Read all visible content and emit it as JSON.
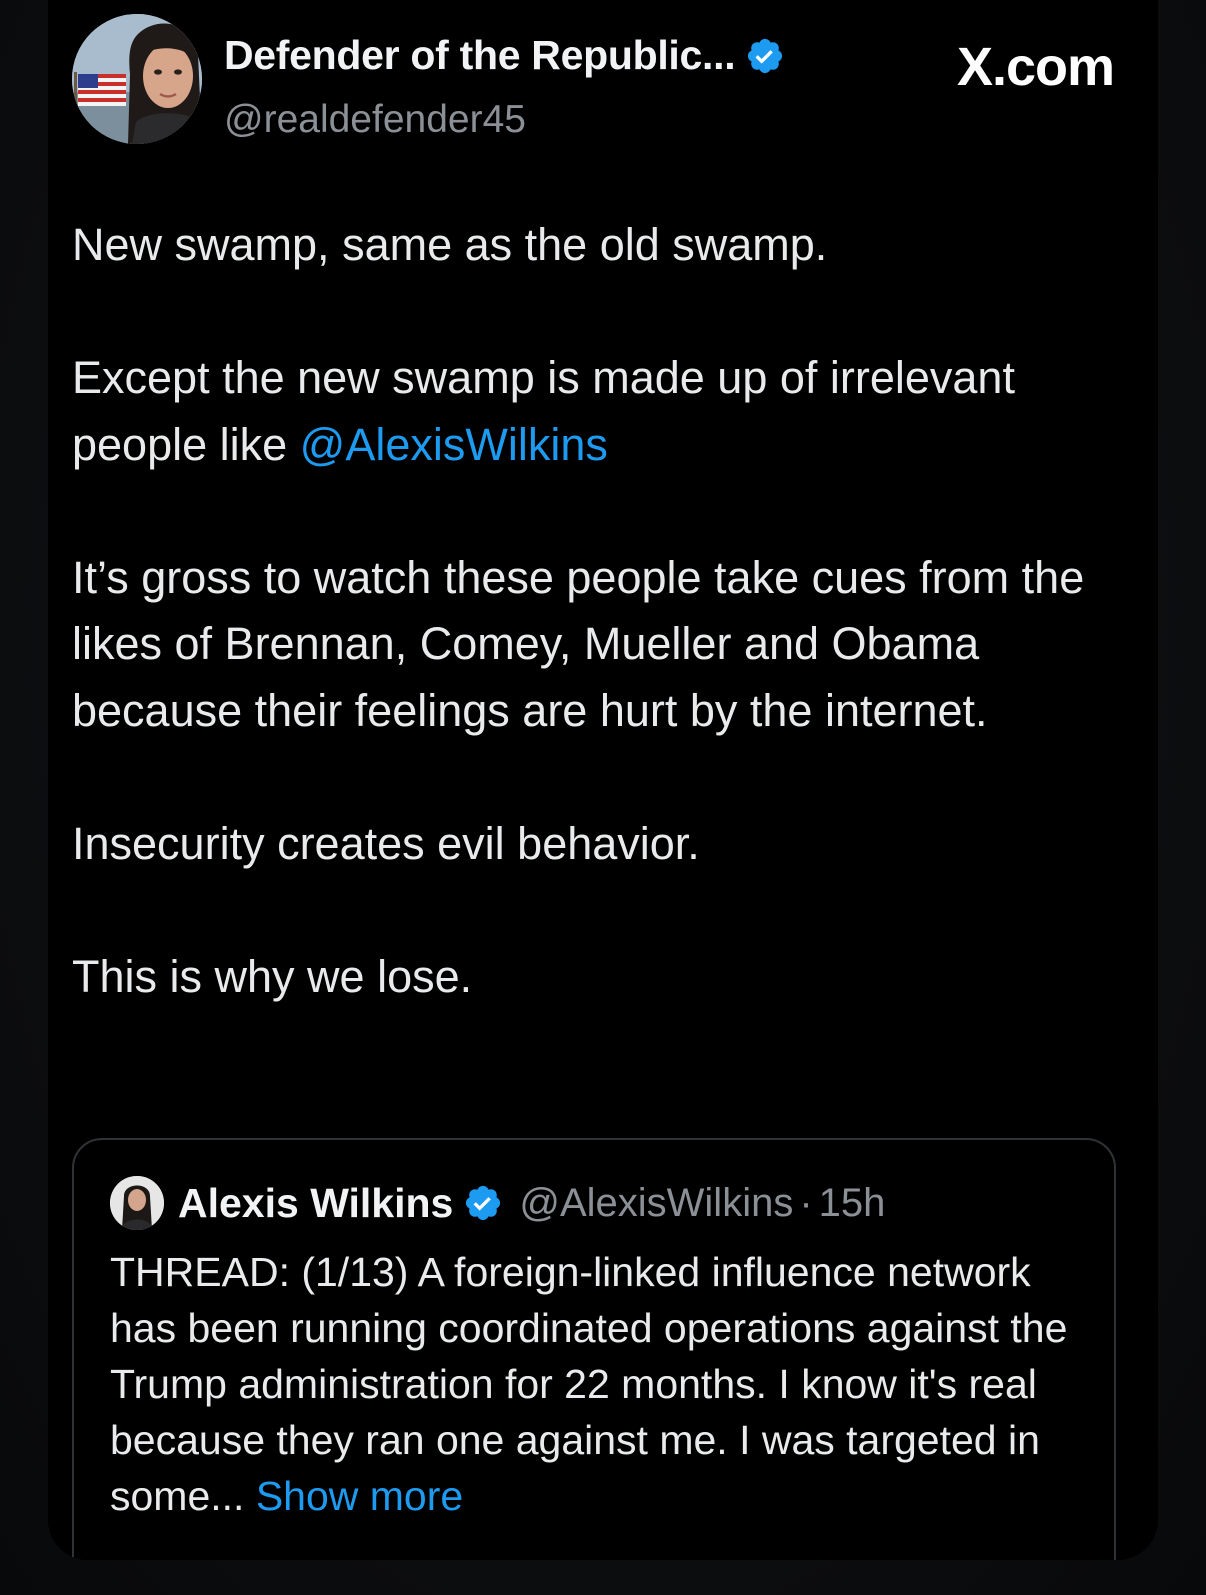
{
  "post": {
    "author": {
      "display_name": "Defender of the Republic...",
      "handle": "@realdefender45",
      "verified": true,
      "avatar": "woman-portrait-with-us-flag-avatar"
    },
    "brand": "X.com",
    "paragraphs": {
      "p1": "New swamp, same as the old swamp.",
      "p2_before": "Except the new swamp is made up of irrelevant people like ",
      "p2_mention": "@AlexisWilkins",
      "p3": "It’s gross to watch these people take cues from the likes of Brennan, Comey, Mueller and Obama because their feelings are hurt by the internet.",
      "p4": "Insecurity creates evil behavior.",
      "p5": "This is why we lose."
    }
  },
  "quoted_post": {
    "author": {
      "display_name": "Alexis Wilkins",
      "handle": "@AlexisWilkins",
      "separator": "·",
      "time": "15h",
      "verified": true,
      "avatar": "woman-portrait-avatar"
    },
    "text": "THREAD: (1/13) A foreign-linked influence network has been running coordinated operations against the Trump administration for 22 months. I know it's real because they ran one against me. I was targeted in some... ",
    "show_more": "Show more"
  },
  "colors": {
    "background": "#000000",
    "text": "#e9eaeb",
    "muted": "#8b9096",
    "link": "#1d9bf0",
    "verified": "#1d9bf0",
    "border": "#2f3336"
  }
}
